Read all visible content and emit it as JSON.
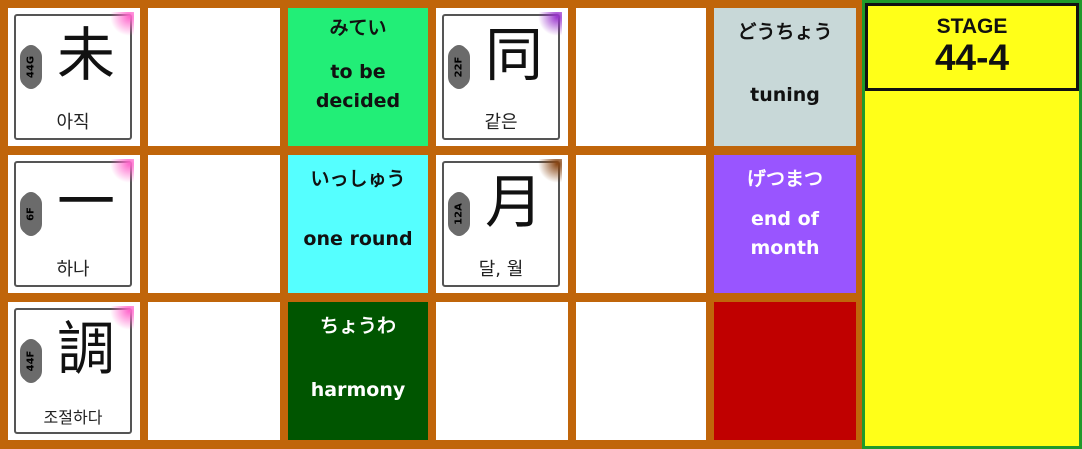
{
  "colors": {
    "board_border": "#c0650a",
    "panel_background": "#ffff18",
    "panel_border": "#1f9a2a",
    "word_mitei": "#22ee77",
    "word_isshuu": "#55ffff",
    "word_chouwa": "#005500",
    "word_douchou": "#c8d8d8",
    "word_getsumatsu": "#9955ff",
    "red_tile": "#c00000"
  },
  "stage": {
    "label": "STAGE",
    "number": "44-4"
  },
  "tiles": {
    "kanji_mi": {
      "kanji": "未",
      "reading": "아직",
      "badge": "44G",
      "glow_color": "#ff66cc"
    },
    "kanji_ichi": {
      "kanji": "一",
      "reading": "하나",
      "badge": "6F",
      "glow_color": "#ff66cc"
    },
    "kanji_chou": {
      "kanji": "調",
      "reading": "조절하다",
      "badge": "44F",
      "glow_color": "#ff66cc"
    },
    "kanji_dou": {
      "kanji": "同",
      "reading": "같은",
      "badge": "22F",
      "glow_color": "#9933cc"
    },
    "kanji_tsuki": {
      "kanji": "月",
      "reading": "달, 월",
      "badge": "12A",
      "glow_color": "#884411"
    },
    "word_mitei": {
      "kana": "みてい",
      "meaning_line1": "to be",
      "meaning_line2": "decided"
    },
    "word_isshuu": {
      "kana": "いっしゅう",
      "meaning_line1": "one round"
    },
    "word_chouwa": {
      "kana": "ちょうわ",
      "meaning_line1": "harmony"
    },
    "word_douchou": {
      "kana": "どうちょう",
      "meaning_line1": "tuning"
    },
    "word_getsumatsu": {
      "kana": "げつまつ",
      "meaning_line1": "end of",
      "meaning_line2": "month"
    }
  }
}
